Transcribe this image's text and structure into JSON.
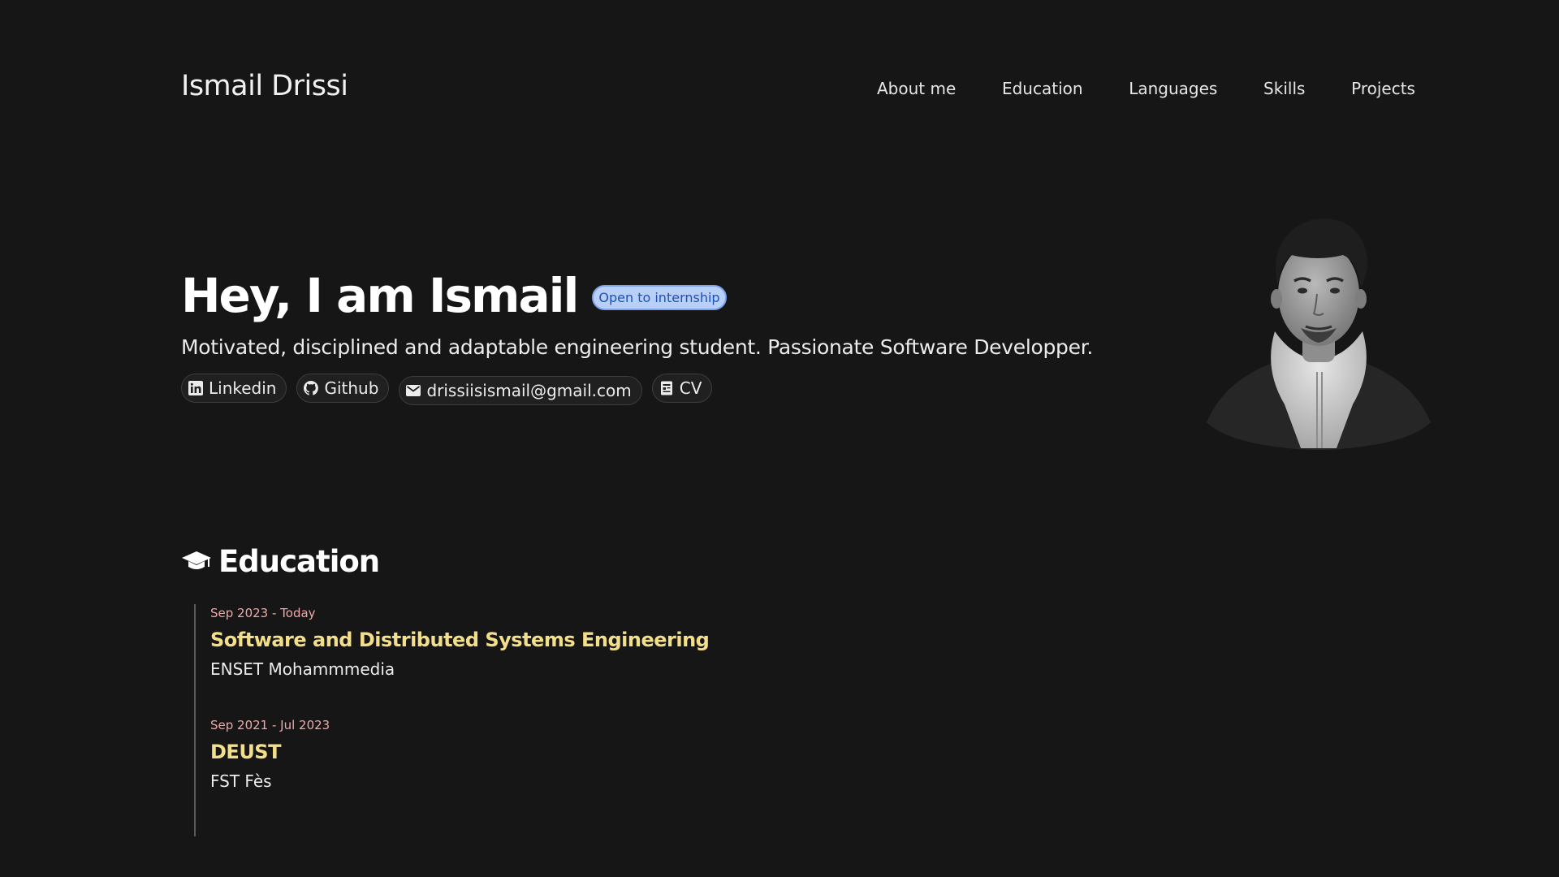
{
  "header": {
    "brand": "Ismail Drissi",
    "nav": [
      "About me",
      "Education",
      "Languages",
      "Skills",
      "Projects"
    ]
  },
  "hero": {
    "title": "Hey, I am Ismail",
    "badge": "Open to internship",
    "subtitle": "Motivated, disciplined and adaptable engineering student. Passionate Software Developper.",
    "links": {
      "linkedin": "Linkedin",
      "github": "Github",
      "email": "drissiisismail@gmail.com",
      "cv": "CV"
    }
  },
  "education": {
    "heading": "Education",
    "entries": [
      {
        "date": "Sep 2023 - Today",
        "degree": "Software and Distributed Systems Engineering",
        "school": "ENSET Mohammmedia"
      },
      {
        "date": "Sep 2021 - Jul 2023",
        "degree": "DEUST",
        "school": "FST Fès"
      }
    ]
  },
  "colors": {
    "background": "#161616",
    "badge_bg": "#b8cff8",
    "badge_text": "#1f50b8",
    "date": "#f0a8a8",
    "degree": "#f3df8a"
  },
  "icons": [
    "linkedin-icon",
    "github-icon",
    "mail-icon",
    "cv-icon",
    "graduation-cap-icon"
  ]
}
